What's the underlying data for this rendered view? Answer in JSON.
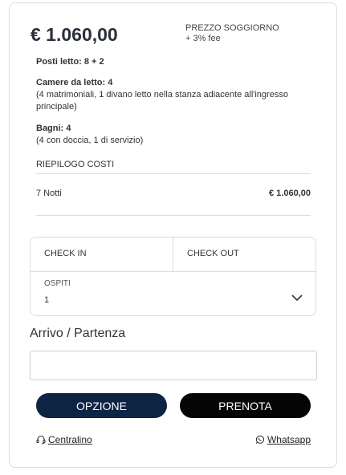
{
  "price": {
    "amount": "€ 1.060,00",
    "label_line1": "PREZZO SOGGIORNO",
    "label_line2": "+ 3% fee"
  },
  "details": {
    "beds": "Posti letto: 8 + 2",
    "bedrooms_title": "Camere da letto: 4",
    "bedrooms_detail": "(4 matrimoniali, 1 divano letto nella stanza adiacente all'ingresso principale)",
    "bathrooms_title": "Bagni: 4",
    "bathrooms_detail": "(4 con doccia, 1 di servizio)"
  },
  "summary": {
    "title": "RIEPILOGO COSTI",
    "rows": [
      {
        "label": "7 Notti",
        "value": "€ 1.060,00"
      }
    ]
  },
  "booking": {
    "checkin_label": "CHECK IN",
    "checkout_label": "CHECK OUT",
    "guests_label": "OSPITI",
    "guests_value": "1"
  },
  "arrival": {
    "label": "Arrivo / Partenza",
    "value": ""
  },
  "buttons": {
    "option": "OPZIONE",
    "book": "PRENOTA"
  },
  "links": {
    "centralino": "Centralino",
    "whatsapp": "Whatsapp"
  },
  "colors": {
    "option_button": "#0e2444",
    "book_button": "#050505"
  },
  "icons": {
    "centralino": "headset-icon",
    "whatsapp": "whatsapp-icon",
    "guests_dropdown": "chevron-down-icon"
  }
}
